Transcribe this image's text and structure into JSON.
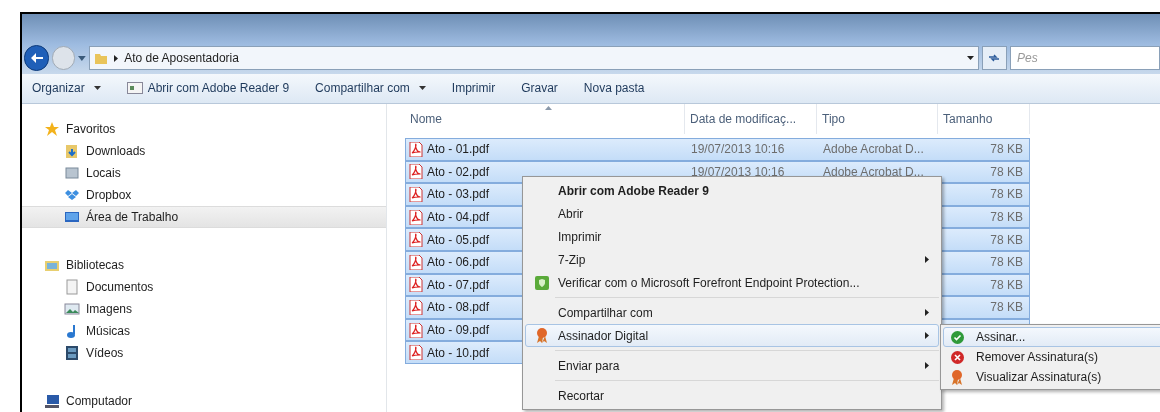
{
  "address_bar": {
    "path": "Ato de Aposentadoria"
  },
  "search": {
    "placeholder": "Pes"
  },
  "toolbar": [
    {
      "label": "Organizar",
      "kind": "dropdown"
    },
    {
      "label": "Abrir com Adobe Reader 9",
      "kind": "app"
    },
    {
      "label": "Compartilhar com",
      "kind": "dropdown"
    },
    {
      "label": "Imprimir",
      "kind": "plain"
    },
    {
      "label": "Gravar",
      "kind": "plain"
    },
    {
      "label": "Nova pasta",
      "kind": "plain"
    }
  ],
  "sidebar": [
    {
      "label": "Favoritos",
      "items": [
        {
          "label": "Downloads",
          "selected": false
        },
        {
          "label": "Locais",
          "selected": false
        },
        {
          "label": "Dropbox",
          "selected": false
        },
        {
          "label": "Área de Trabalho",
          "selected": true
        }
      ]
    },
    {
      "label": "Bibliotecas",
      "items": [
        {
          "label": "Documentos",
          "selected": false
        },
        {
          "label": "Imagens",
          "selected": false
        },
        {
          "label": "Músicas",
          "selected": false
        },
        {
          "label": "Vídeos",
          "selected": false
        }
      ]
    },
    {
      "label": "Computador"
    }
  ],
  "file_list": {
    "columns": [
      {
        "label": "Nome",
        "sorted": true
      },
      {
        "label": "Data de modificaç...",
        "sorted": false
      },
      {
        "label": "Tipo",
        "sorted": false
      },
      {
        "label": "Tamanho",
        "sorted": false
      }
    ],
    "rows": [
      {
        "name": "Ato - 01.pdf",
        "date": "19/07/2013 10:16",
        "type": "Adobe Acrobat D...",
        "size": "78 KB",
        "selected": true
      },
      {
        "name": "Ato - 02.pdf",
        "date": "19/07/2013 10:16",
        "type": "Adobe Acrobat D...",
        "size": "78 KB",
        "selected": true
      },
      {
        "name": "Ato - 03.pdf",
        "size": "78 KB",
        "selected": true
      },
      {
        "name": "Ato - 04.pdf",
        "size": "78 KB",
        "selected": true
      },
      {
        "name": "Ato - 05.pdf",
        "size": "78 KB",
        "selected": true
      },
      {
        "name": "Ato - 06.pdf",
        "size": "78 KB",
        "selected": true
      },
      {
        "name": "Ato - 07.pdf",
        "size": "78 KB",
        "selected": true
      },
      {
        "name": "Ato - 08.pdf",
        "size": "78 KB",
        "selected": true
      },
      {
        "name": "Ato - 09.pdf",
        "selected": true
      },
      {
        "name": "Ato - 10.pdf",
        "selected": true
      }
    ]
  },
  "context_menu": [
    {
      "kind": "item",
      "label": "Abrir com Adobe Reader 9",
      "bold": true,
      "submenu": false,
      "highlighted": false
    },
    {
      "kind": "item",
      "label": "Abrir",
      "bold": false,
      "submenu": false,
      "highlighted": false
    },
    {
      "kind": "item",
      "label": "Imprimir",
      "bold": false,
      "submenu": false,
      "highlighted": false
    },
    {
      "kind": "item",
      "label": "7-Zip",
      "bold": false,
      "submenu": true,
      "highlighted": false
    },
    {
      "kind": "item",
      "label": "Verificar com o Microsoft Forefront Endpoint Protection...",
      "bold": false,
      "submenu": false,
      "highlighted": false
    },
    {
      "kind": "separator"
    },
    {
      "kind": "item",
      "label": "Compartilhar com",
      "bold": false,
      "submenu": true,
      "highlighted": false
    },
    {
      "kind": "item",
      "label": "Assinador Digital",
      "bold": false,
      "submenu": true,
      "highlighted": true
    },
    {
      "kind": "separator"
    },
    {
      "kind": "item",
      "label": "Enviar para",
      "bold": false,
      "submenu": true,
      "highlighted": false
    },
    {
      "kind": "separator"
    },
    {
      "kind": "item",
      "label": "Recortar",
      "bold": false,
      "submenu": false,
      "highlighted": false
    }
  ],
  "submenu": [
    {
      "label": "Assinar...",
      "selected": true
    },
    {
      "label": "Remover Assinatura(s)",
      "selected": false
    },
    {
      "label": "Visualizar Assinatura(s)",
      "selected": false
    }
  ]
}
